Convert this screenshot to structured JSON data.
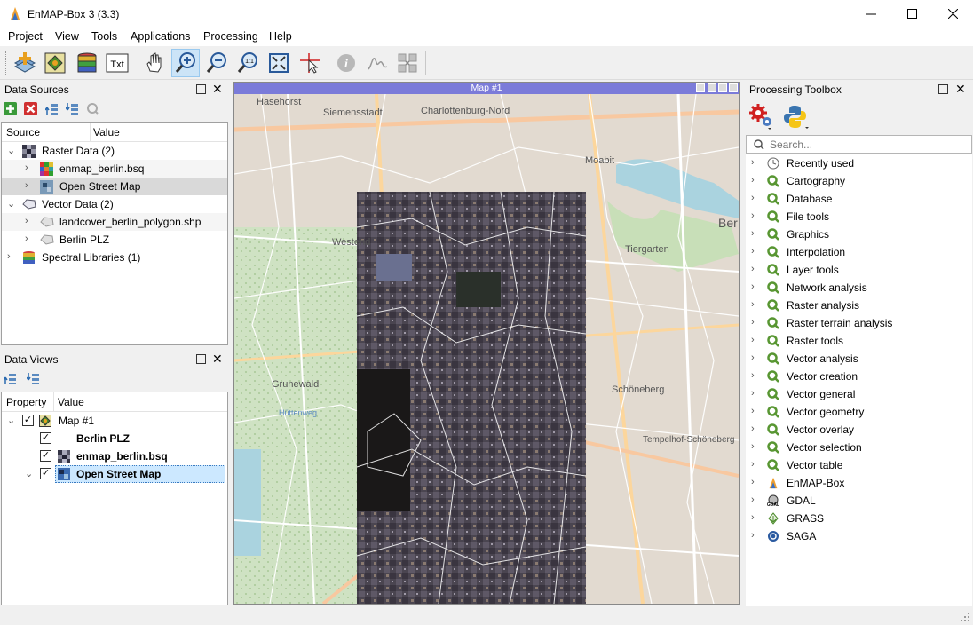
{
  "window": {
    "title": "EnMAP-Box 3 (3.3)"
  },
  "menu": [
    "Project",
    "View",
    "Tools",
    "Applications",
    "Processing",
    "Help"
  ],
  "toolbar": {
    "buttons": [
      "add-data-source",
      "open-map-view",
      "open-spectral-library",
      "open-text-view",
      "pan",
      "zoom-in",
      "zoom-out",
      "zoom-native",
      "zoom-full-extent",
      "select-location",
      "identify",
      "spectral-profile",
      "sync-maps"
    ],
    "active": "zoom-in"
  },
  "data_sources": {
    "title": "Data Sources",
    "columns": [
      "Source",
      "Value"
    ],
    "items": [
      {
        "label": "Raster Data (2)",
        "level": 0,
        "expanded": true
      },
      {
        "label": "enmap_berlin.bsq",
        "level": 1
      },
      {
        "label": "Open Street Map",
        "level": 1,
        "selected": true
      },
      {
        "label": "Vector Data (2)",
        "level": 0,
        "expanded": true
      },
      {
        "label": "landcover_berlin_polygon.shp",
        "level": 1
      },
      {
        "label": "Berlin PLZ",
        "level": 1
      },
      {
        "label": "Spectral Libraries (1)",
        "level": 0
      }
    ]
  },
  "data_views": {
    "title": "Data Views",
    "columns": [
      "Property",
      "Value"
    ],
    "items": [
      {
        "label": "Map #1",
        "checked": true
      },
      {
        "label": "Berlin PLZ",
        "checked": true
      },
      {
        "label": "enmap_berlin.bsq",
        "checked": true
      },
      {
        "label": "Open Street Map",
        "checked": true,
        "selected": true
      }
    ]
  },
  "map": {
    "title": "Map #1",
    "place_labels": [
      "Hasehorst",
      "Siemensstadt",
      "Charlottenburg-Nord",
      "Moabit",
      "Westend",
      "Tiergarten",
      "Ber",
      "Grunewald",
      "Schöneberg",
      "Tempelhof-Schöneberg",
      "Hüttenweg"
    ]
  },
  "processing": {
    "title": "Processing Toolbox",
    "search_placeholder": "Search...",
    "groups": [
      "Recently used",
      "Cartography",
      "Database",
      "File tools",
      "Graphics",
      "Interpolation",
      "Layer tools",
      "Network analysis",
      "Raster analysis",
      "Raster terrain analysis",
      "Raster tools",
      "Vector analysis",
      "Vector creation",
      "Vector general",
      "Vector geometry",
      "Vector overlay",
      "Vector selection",
      "Vector table",
      "EnMAP-Box",
      "GDAL",
      "GRASS",
      "SAGA"
    ]
  },
  "colors": {
    "map_titlebar": "#7b7bd9",
    "selection": "#cce8ff",
    "qgis_green": "#589632"
  }
}
